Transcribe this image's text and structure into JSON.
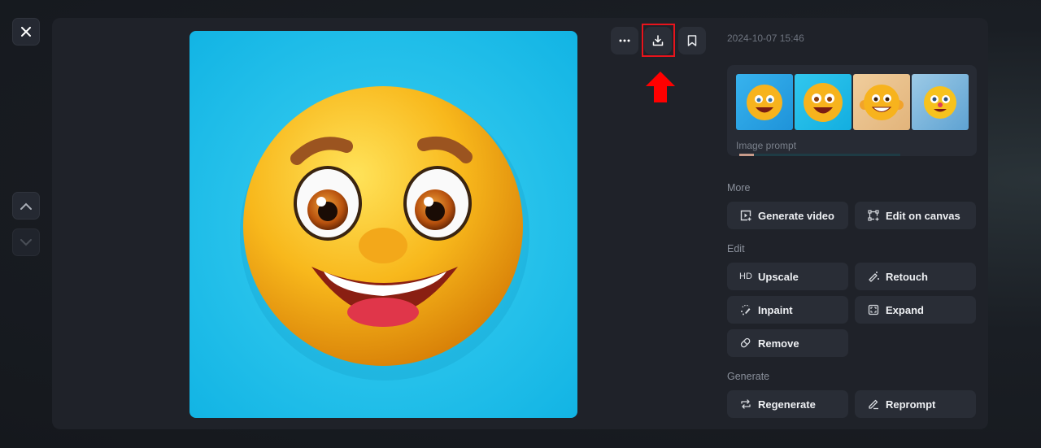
{
  "nav": {
    "close_icon": "close-icon",
    "prev_icon": "chevron-up-icon",
    "next_icon": "chevron-down-icon"
  },
  "toolbar": {
    "more_icon": "more-horizontal-icon",
    "download_icon": "download-icon",
    "bookmark_icon": "bookmark-icon"
  },
  "annotation": {
    "highlight_color": "#e8141c",
    "arrow_color": "#ff0000",
    "target": "download-button"
  },
  "details": {
    "timestamp": "2024-10-07 15:46",
    "image_prompt_label": "Image prompt",
    "thumbnails": [
      {
        "name": "smiley-thumb-1",
        "bg": "#2aa6e8"
      },
      {
        "name": "smiley-thumb-2",
        "bg": "#1fbbe8"
      },
      {
        "name": "smiley-thumb-3",
        "bg": "#e9c18b"
      },
      {
        "name": "smiley-thumb-4",
        "bg": "#7fb6dc"
      }
    ]
  },
  "sections": {
    "more": {
      "label": "More",
      "buttons": [
        {
          "label": "Generate video",
          "icon": "video-plus-icon"
        },
        {
          "label": "Edit on canvas",
          "icon": "canvas-edit-icon"
        }
      ]
    },
    "edit": {
      "label": "Edit",
      "buttons": [
        {
          "label": "Upscale",
          "icon": "hd-icon",
          "icon_text": "HD"
        },
        {
          "label": "Retouch",
          "icon": "magic-wand-icon"
        },
        {
          "label": "Inpaint",
          "icon": "inpaint-brush-icon"
        },
        {
          "label": "Expand",
          "icon": "expand-icon"
        },
        {
          "label": "Remove",
          "icon": "eraser-icon"
        }
      ]
    },
    "generate": {
      "label": "Generate",
      "buttons": [
        {
          "label": "Regenerate",
          "icon": "repeat-icon"
        },
        {
          "label": "Reprompt",
          "icon": "pencil-icon"
        }
      ]
    }
  },
  "main_image": {
    "subject": "3D smiling yellow emoji face on light blue background",
    "background_color": "#2ac4ec",
    "face_color": "#f5b41d"
  }
}
